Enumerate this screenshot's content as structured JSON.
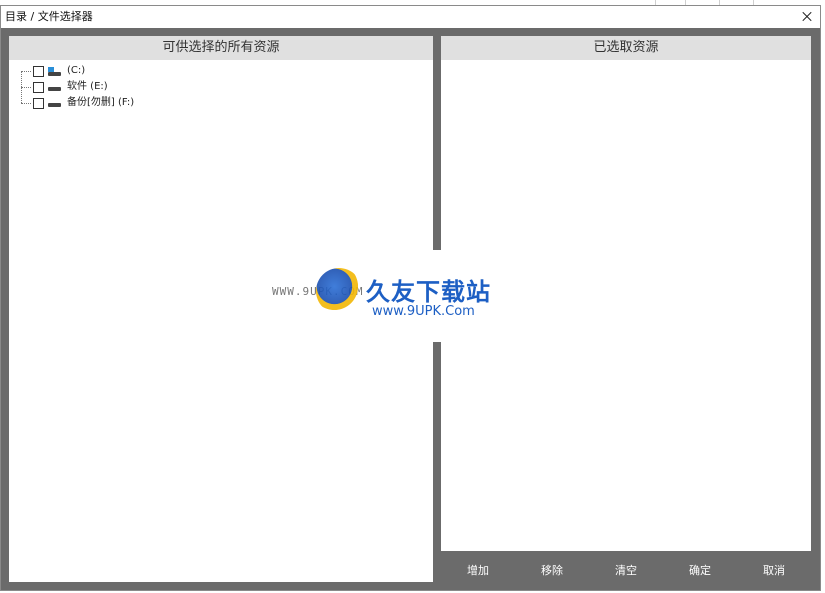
{
  "window": {
    "title": "目录 / 文件选择器"
  },
  "left_panel": {
    "header": "可供选择的所有资源",
    "drives": [
      {
        "label": "(C:)",
        "icon": "system-drive-icon",
        "checked": false
      },
      {
        "label": "软件 (E:)",
        "icon": "hard-drive-icon",
        "checked": false
      },
      {
        "label": "备份[勿删] (F:)",
        "icon": "hard-drive-icon",
        "checked": false
      }
    ]
  },
  "right_panel": {
    "header": "已选取资源"
  },
  "buttons": {
    "add": "增加",
    "remove": "移除",
    "clear": "清空",
    "confirm": "确定",
    "cancel": "取消"
  },
  "watermark": {
    "url": "WWW.9UPK.COM",
    "title": "久友下载站",
    "subtitle": "www.9UPK.Com"
  },
  "colors": {
    "background": "#6b6b6b",
    "panel_header": "#e0e0e0",
    "accent_blue": "#2a8fd8"
  }
}
